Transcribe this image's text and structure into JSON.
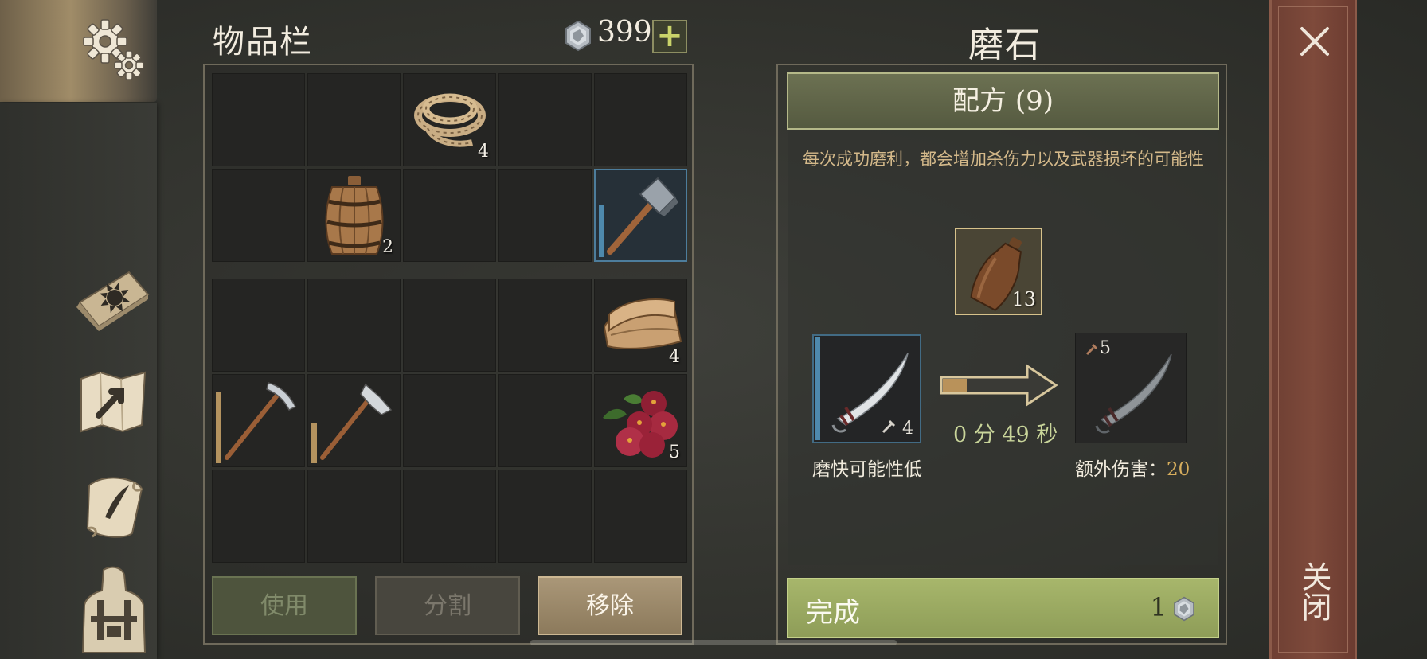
{
  "inventory": {
    "title": "物品栏",
    "currency": "399",
    "add_label": "+",
    "slots": [
      {
        "count": ""
      },
      {
        "count": ""
      },
      {
        "item": "rope",
        "count": "4"
      },
      {
        "count": ""
      },
      {
        "count": ""
      },
      {
        "count": ""
      },
      {
        "item": "barrel",
        "count": "2"
      },
      {
        "count": ""
      },
      {
        "count": ""
      },
      {
        "item": "hammer",
        "count": "",
        "active": true
      },
      {
        "count": ""
      },
      {
        "count": ""
      },
      {
        "count": ""
      },
      {
        "count": ""
      },
      {
        "item": "cloth",
        "count": "4"
      },
      {
        "item": "pickaxe",
        "count": ""
      },
      {
        "item": "axe",
        "count": ""
      },
      {
        "count": ""
      },
      {
        "count": ""
      },
      {
        "item": "berries",
        "count": "5"
      },
      {
        "count": ""
      },
      {
        "count": ""
      },
      {
        "count": ""
      },
      {
        "count": ""
      },
      {
        "count": ""
      }
    ],
    "buttons": {
      "use": "使用",
      "split": "分割",
      "remove": "移除"
    }
  },
  "crafting": {
    "title": "磨石",
    "recipe_button": "配方 (9)",
    "description": "每次成功磨利，都会增加杀伤力以及武器损坏的可能性",
    "material_count": "13",
    "source_count": "4",
    "result_count": "5",
    "time": "0 分 49 秒",
    "source_label": "磨快可能性低",
    "bonus_label": "额外伤害：",
    "bonus_value": "20",
    "finish_label": "完成",
    "finish_cost": "1"
  },
  "close": {
    "label": "关闭"
  },
  "colors": {
    "accent_green": "#8e9d58",
    "close_red": "#7e4a3b",
    "highlight_gold": "#d7ae5d",
    "selected_blue": "#4d7d9c"
  },
  "icons": [
    "settings-gears-icon",
    "skills-book-icon",
    "map-icon",
    "journal-scroll-icon",
    "character-icon",
    "silver-coin-icon",
    "close-icon",
    "arrow-right-icon",
    "rope-icon",
    "barrel-icon",
    "hammer-icon",
    "cloth-icon",
    "pickaxe-icon",
    "axe-icon",
    "berries-icon",
    "leather-flask-icon",
    "saber-icon"
  ]
}
